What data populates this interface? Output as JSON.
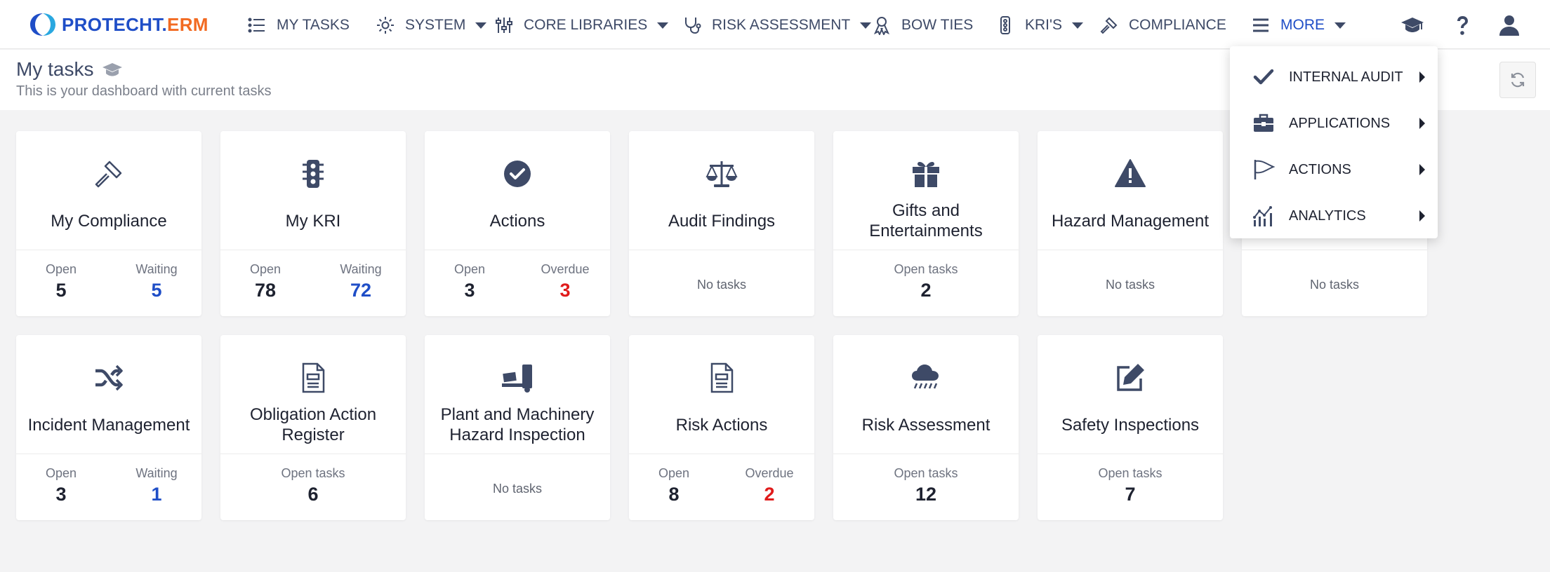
{
  "brand": {
    "name_part1": "PROTECHT.",
    "name_part2": "ERM"
  },
  "nav": {
    "items": [
      {
        "label": "MY TASKS",
        "icon": "list-icon"
      },
      {
        "label": "SYSTEM",
        "icon": "gear-icon"
      },
      {
        "label": "CORE LIBRARIES",
        "icon": "sliders-icon"
      },
      {
        "label": "RISK ASSESSMENT",
        "icon": "stethoscope-icon"
      },
      {
        "label": "BOW TIES",
        "icon": "ribbon-icon"
      },
      {
        "label": "KRI'S",
        "icon": "traffic-light-icon"
      },
      {
        "label": "COMPLIANCE",
        "icon": "gavel-icon"
      },
      {
        "label": "MORE",
        "icon": "menu-icon"
      }
    ],
    "right_icons": [
      "graduation-cap-icon",
      "help-icon",
      "user-icon"
    ]
  },
  "header": {
    "title": "My tasks",
    "subtitle": "This is your dashboard with current tasks"
  },
  "more_menu": {
    "items": [
      {
        "label": "INTERNAL AUDIT",
        "icon": "check-icon"
      },
      {
        "label": "APPLICATIONS",
        "icon": "briefcase-icon"
      },
      {
        "label": "ACTIONS",
        "icon": "flag-icon"
      },
      {
        "label": "ANALYTICS",
        "icon": "chart-icon"
      }
    ]
  },
  "cards": [
    {
      "title": "My Compliance",
      "icon": "gavel-icon",
      "stats": [
        {
          "label": "Open",
          "value": "5"
        },
        {
          "label": "Waiting",
          "value": "5"
        }
      ]
    },
    {
      "title": "My KRI",
      "icon": "traffic-light-icon",
      "stats": [
        {
          "label": "Open",
          "value": "78"
        },
        {
          "label": "Waiting",
          "value": "72"
        }
      ]
    },
    {
      "title": "Actions",
      "icon": "check-circle-icon",
      "stats": [
        {
          "label": "Open",
          "value": "3"
        },
        {
          "label": "Overdue",
          "value": "3"
        }
      ]
    },
    {
      "title": "Audit Findings",
      "icon": "scale-icon",
      "empty": "No tasks"
    },
    {
      "title": "Gifts and Entertainments",
      "icon": "gift-icon",
      "stats": [
        {
          "label": "Open tasks",
          "value": "2"
        }
      ]
    },
    {
      "title": "Hazard Management",
      "icon": "warning-icon",
      "empty": "No tasks"
    },
    {
      "title": "",
      "icon": "",
      "empty": "No tasks"
    },
    {
      "title": "Incident Management",
      "icon": "shuffle-icon",
      "stats": [
        {
          "label": "Open",
          "value": "3"
        },
        {
          "label": "Waiting",
          "value": "1"
        }
      ]
    },
    {
      "title": "Obligation Action Register",
      "icon": "document-icon",
      "stats": [
        {
          "label": "Open tasks",
          "value": "6"
        }
      ]
    },
    {
      "title": "Plant and Machinery Hazard Inspection",
      "icon": "forklift-icon",
      "empty": "No tasks"
    },
    {
      "title": "Risk Actions",
      "icon": "document-icon",
      "stats": [
        {
          "label": "Open",
          "value": "8"
        },
        {
          "label": "Overdue",
          "value": "2"
        }
      ]
    },
    {
      "title": "Risk Assessment",
      "icon": "cloud-rain-icon",
      "stats": [
        {
          "label": "Open tasks",
          "value": "12"
        }
      ]
    },
    {
      "title": "Safety Inspections",
      "icon": "edit-icon",
      "stats": [
        {
          "label": "Open tasks",
          "value": "7"
        }
      ]
    }
  ],
  "colors": {
    "accent": "#1f4ec7",
    "brand_orange": "#f26a21",
    "overdue": "#e01b1b",
    "icon": "#3e4a67"
  }
}
